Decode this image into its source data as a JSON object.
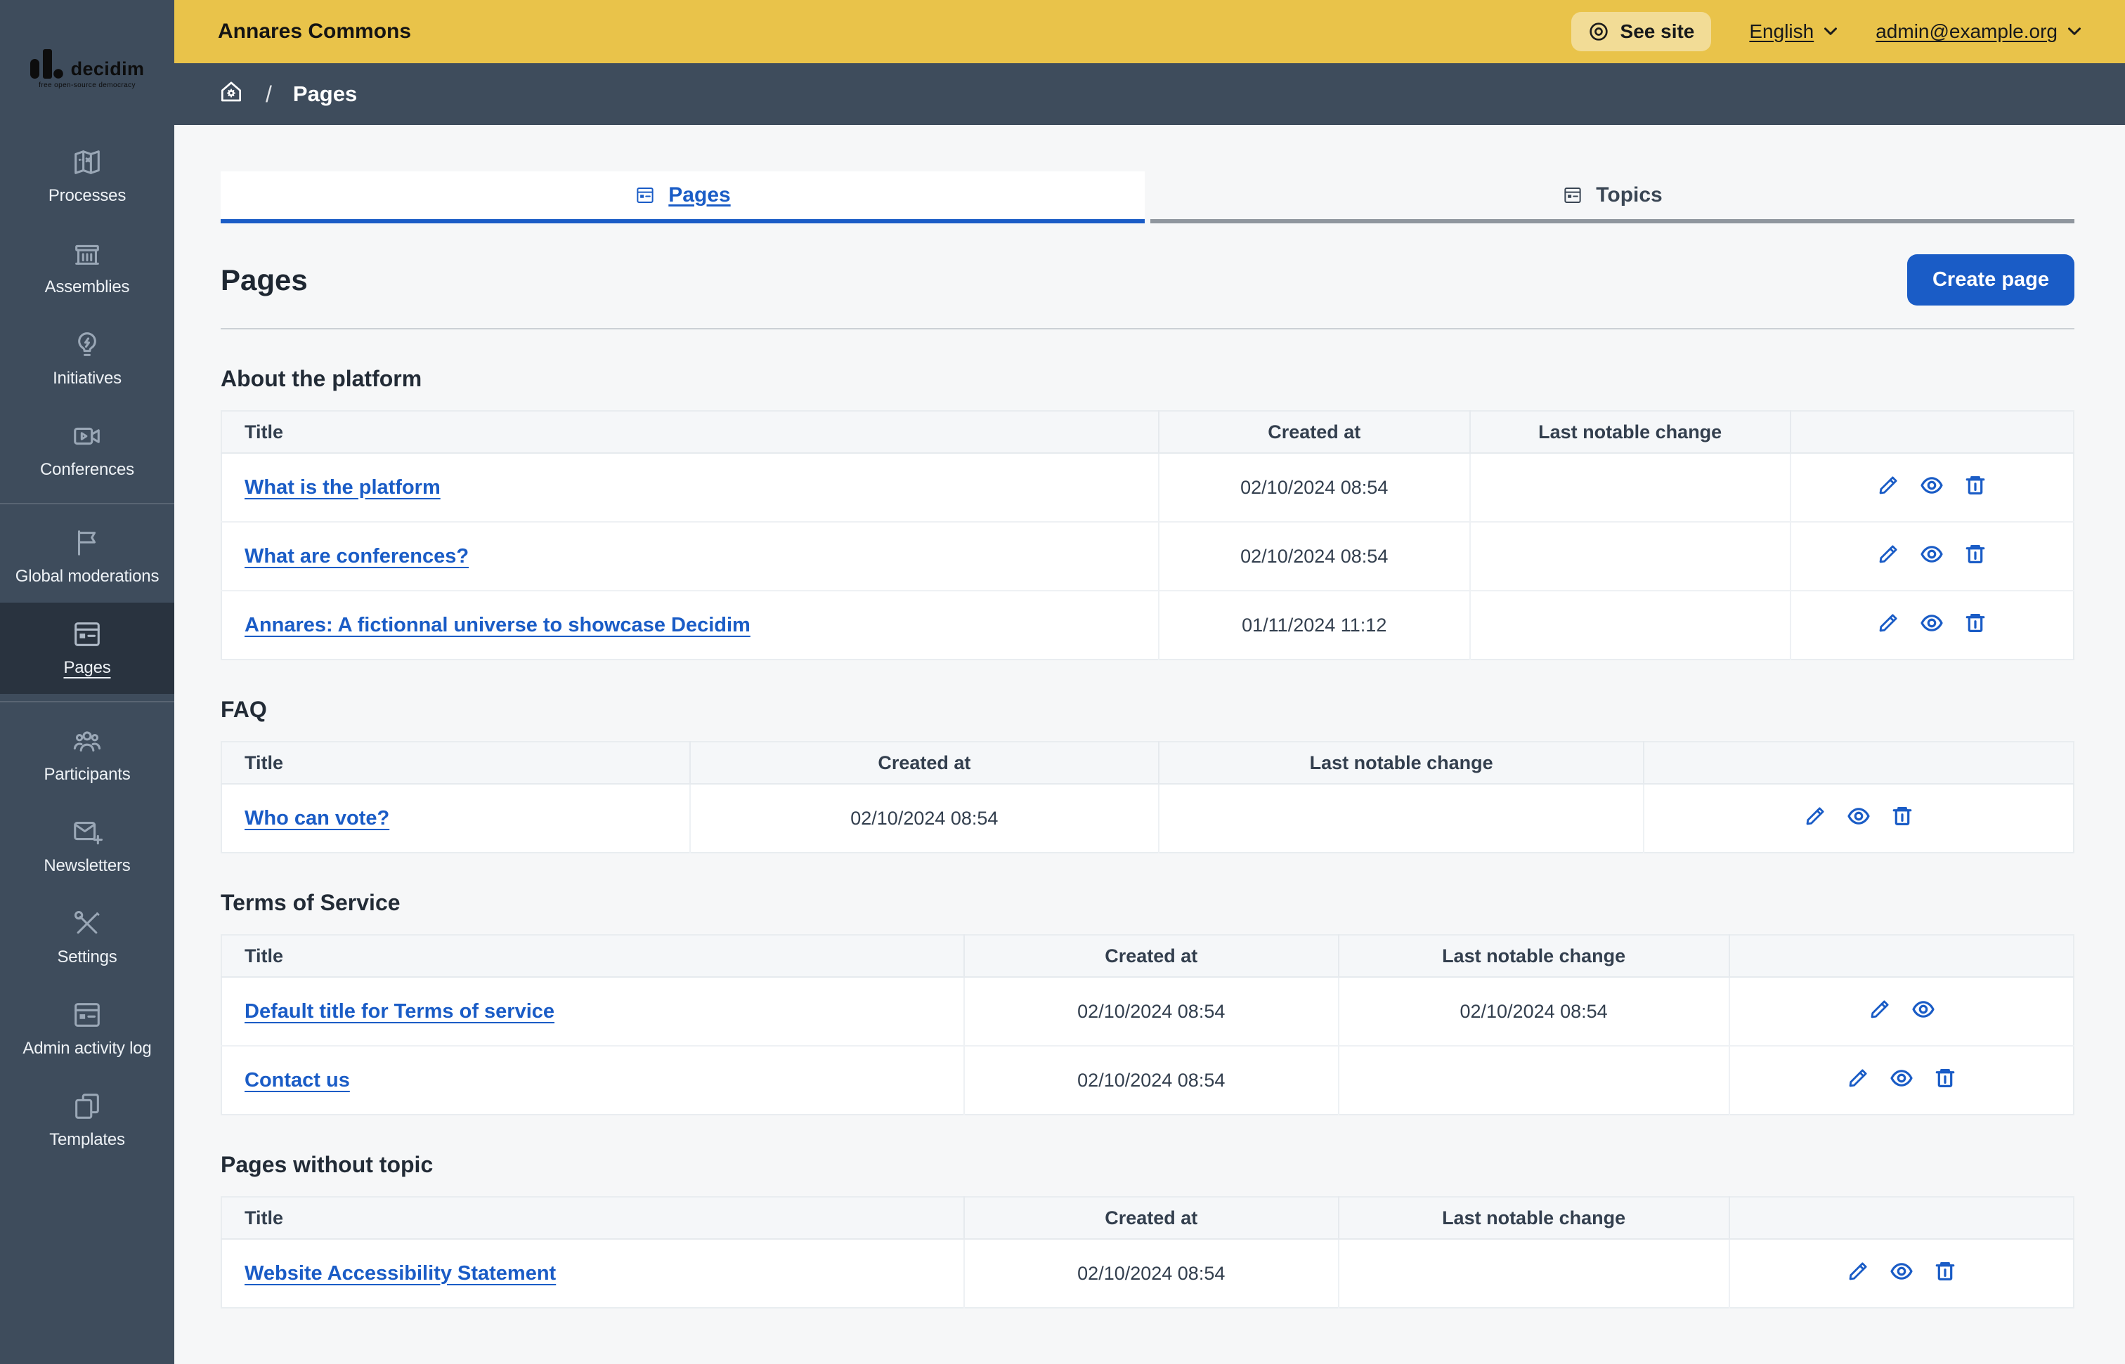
{
  "colors": {
    "accent_blue": "#1a5cc6",
    "topbar_yellow": "#e9c34a",
    "sidebar_dark": "#3e4c5c",
    "sidebar_selected": "#29333f",
    "content_bg": "#f6f7f8",
    "table_header_bg": "#f5f7f9",
    "inactive_tab_border": "#8f969e"
  },
  "topbar": {
    "title": "Annares Commons",
    "see_site_label": "See site",
    "language_label": "English",
    "account_label": "admin@example.org"
  },
  "breadcrumb": {
    "current": "Pages"
  },
  "sidebar": {
    "logo": {
      "brand": "decidim",
      "tagline": "free open-source democracy"
    },
    "groups": [
      {
        "items": [
          {
            "label": "Processes",
            "icon": "map-icon",
            "active": false
          },
          {
            "label": "Assemblies",
            "icon": "government-icon",
            "active": false
          },
          {
            "label": "Initiatives",
            "icon": "lightbulb-icon",
            "active": false
          },
          {
            "label": "Conferences",
            "icon": "video-icon",
            "active": false
          }
        ]
      },
      {
        "items": [
          {
            "label": "Global moderations",
            "icon": "flag-icon",
            "active": false
          },
          {
            "label": "Pages",
            "icon": "article-icon",
            "active": true
          }
        ]
      },
      {
        "items": [
          {
            "label": "Participants",
            "icon": "team-icon",
            "active": false
          },
          {
            "label": "Newsletters",
            "icon": "mail-add-icon",
            "active": false
          },
          {
            "label": "Settings",
            "icon": "tools-icon",
            "active": false
          },
          {
            "label": "Admin activity log",
            "icon": "article-icon",
            "active": false
          },
          {
            "label": "Templates",
            "icon": "copy-icon",
            "active": false
          }
        ]
      }
    ]
  },
  "tabs": [
    {
      "label": "Pages",
      "icon": "article-icon",
      "active": true
    },
    {
      "label": "Topics",
      "icon": "article-icon",
      "active": false
    }
  ],
  "page": {
    "title": "Pages",
    "create_button_label": "Create page"
  },
  "table_columns": [
    "Title",
    "Created at",
    "Last notable change",
    ""
  ],
  "sections": [
    {
      "heading": "About the platform",
      "col_widths": [
        "50.6%",
        "16.8%",
        "17.3%",
        "15.3%"
      ],
      "rows": [
        {
          "title": "What is the platform",
          "created_at": "02/10/2024 08:54",
          "last_change": "",
          "actions": [
            "edit",
            "preview",
            "delete"
          ]
        },
        {
          "title": "What are conferences?",
          "created_at": "02/10/2024 08:54",
          "last_change": "",
          "actions": [
            "edit",
            "preview",
            "delete"
          ]
        },
        {
          "title": "Annares: A fictionnal universe to showcase Decidim",
          "created_at": "01/11/2024 11:12",
          "last_change": "",
          "actions": [
            "edit",
            "preview",
            "delete"
          ]
        }
      ]
    },
    {
      "heading": "FAQ",
      "col_widths": [
        "25.3%",
        "25.3%",
        "26.2%",
        "23.2%"
      ],
      "rows": [
        {
          "title": "Who can vote?",
          "created_at": "02/10/2024 08:54",
          "last_change": "",
          "actions": [
            "edit",
            "preview",
            "delete"
          ]
        }
      ]
    },
    {
      "heading": "Terms of Service",
      "col_widths": [
        "40.1%",
        "20.2%",
        "21.1%",
        "18.6%"
      ],
      "rows": [
        {
          "title": "Default title for Terms of service",
          "created_at": "02/10/2024 08:54",
          "last_change": "02/10/2024 08:54",
          "actions": [
            "edit",
            "preview"
          ]
        },
        {
          "title": "Contact us",
          "created_at": "02/10/2024 08:54",
          "last_change": "",
          "actions": [
            "edit",
            "preview",
            "delete"
          ]
        }
      ]
    },
    {
      "heading": "Pages without topic",
      "col_widths": [
        "40.1%",
        "20.2%",
        "21.1%",
        "18.6%"
      ],
      "rows": [
        {
          "title": "Website Accessibility Statement",
          "created_at": "02/10/2024 08:54",
          "last_change": "",
          "actions": [
            "edit",
            "preview",
            "delete"
          ]
        }
      ]
    }
  ]
}
